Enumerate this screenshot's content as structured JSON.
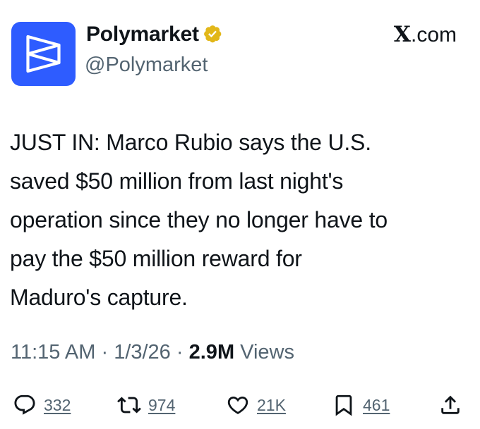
{
  "profile": {
    "display_name": "Polymarket",
    "handle": "@Polymarket",
    "avatar_icon": "polymarket-logo",
    "avatar_color": "#2E5CFF",
    "verified_icon": "gold-verified-badge",
    "verified_color": "#E2B719"
  },
  "source": {
    "brand": "X",
    "suffix": ".com"
  },
  "tweet": {
    "text": "JUST IN: Marco Rubio says the U.S.\nsaved $50 million from last night's\noperation since they no longer have to\npay the $50 million reward for\nMaduro's capture."
  },
  "meta": {
    "time": "11:15 AM",
    "separator": "·",
    "date": "1/3/26",
    "views_count": "2.9M",
    "views_label": "Views"
  },
  "actions": {
    "replies": {
      "icon": "reply-icon",
      "count": "332"
    },
    "reposts": {
      "icon": "repost-icon",
      "count": "974"
    },
    "likes": {
      "icon": "heart-icon",
      "count": "21K"
    },
    "bookmarks": {
      "icon": "bookmark-icon",
      "count": "461"
    },
    "share": {
      "icon": "share-icon"
    }
  }
}
